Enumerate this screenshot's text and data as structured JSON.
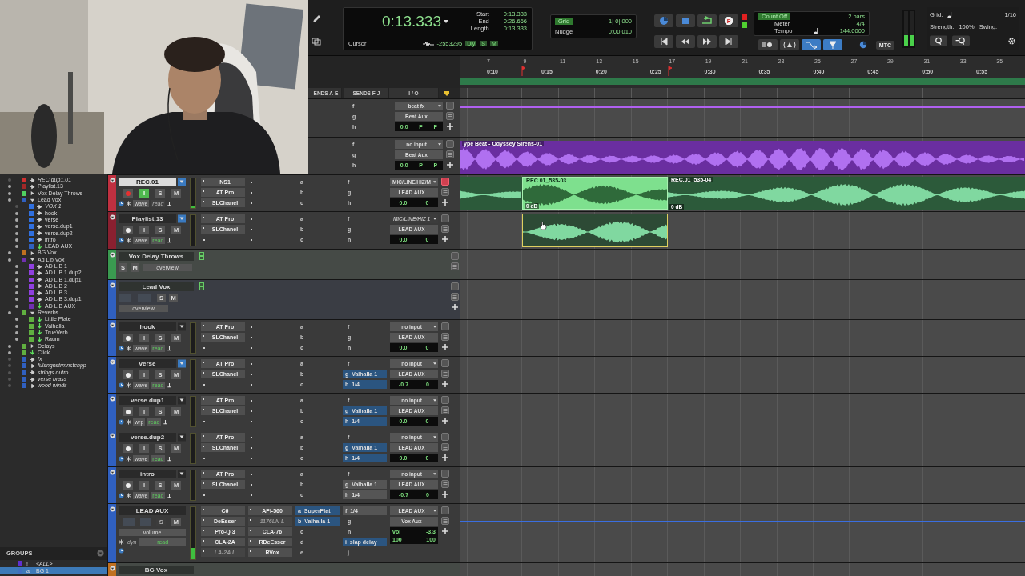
{
  "toolbar": {
    "counter": {
      "main": "0:13.333",
      "cursor_label": "Cursor",
      "cursor_value": "-2553295",
      "flags": [
        {
          "label": "Dly",
          "on": true
        },
        {
          "label": "S",
          "on": true
        },
        {
          "label": "M",
          "on": true
        }
      ],
      "rows": [
        {
          "label": "Start",
          "value": "0:13.333"
        },
        {
          "label": "End",
          "value": "0:26.666"
        },
        {
          "label": "Length",
          "value": "0:13.333"
        }
      ]
    },
    "grid": {
      "label": "Grid",
      "on": true,
      "value": "1| 0| 000",
      "nudge_label": "Nudge",
      "nudge_value": "0:00.010"
    },
    "record_label": "P",
    "count": {
      "count_off": "Count Off",
      "count_off_on": true,
      "bars": "2 bars",
      "meter_label": "Meter",
      "meter": "4/4",
      "tempo_label": "Tempo",
      "tempo": "144.0000"
    },
    "mode_buttons": [
      {
        "on": false
      },
      {
        "on": false
      },
      {
        "on": true
      },
      {
        "on": true
      }
    ],
    "sync_label": "MTC",
    "master_meter": [
      {
        "level": 0.32
      },
      {
        "level": 0.32
      }
    ],
    "quantize": {
      "grid_label": "Grid:",
      "grid_value": "1/16",
      "strength_label": "Strength:",
      "strength": "100%",
      "swing_label": "Swing:"
    }
  },
  "ruler": {
    "bars": [
      "7",
      "9",
      "11",
      "13",
      "15",
      "17",
      "19",
      "21",
      "23",
      "25",
      "27",
      "29",
      "31",
      "33",
      "35"
    ],
    "times": [
      "0:10",
      "0:15",
      "0:20",
      "0:25",
      "0:30",
      "0:35",
      "0:40",
      "0:45",
      "0:50",
      "0:55"
    ]
  },
  "track_list": [
    {
      "name": "REC.dup1.01",
      "kind": "audio",
      "color": "#d03030",
      "inactive": true
    },
    {
      "name": "Playlist.13",
      "kind": "audio",
      "color": "#a02828",
      "inactive": false
    },
    {
      "name": "Vox Delay Throws",
      "kind": "folder",
      "color": "#50d060",
      "inactive": false,
      "expanded": false
    },
    {
      "name": "Lead Vox",
      "kind": "folder",
      "color": "#3060c0",
      "inactive": false,
      "expanded": true,
      "children": [
        {
          "name": "VOX 1",
          "kind": "audio",
          "color": "#3070e0",
          "inactive": true
        },
        {
          "name": "hook",
          "kind": "audio",
          "color": "#3070e0",
          "inactive": false
        },
        {
          "name": "verse",
          "kind": "audio",
          "color": "#3070e0",
          "inactive": false
        },
        {
          "name": "verse.dup1",
          "kind": "audio",
          "color": "#3070e0",
          "inactive": false
        },
        {
          "name": "verse.dup2",
          "kind": "audio",
          "color": "#3070e0",
          "inactive": false
        },
        {
          "name": "intro",
          "kind": "audio",
          "color": "#3070e0",
          "inactive": false
        },
        {
          "name": "LEAD AUX",
          "kind": "aux",
          "color": "#3060c0",
          "inactive": false
        }
      ]
    },
    {
      "name": "BG Vox",
      "kind": "folder",
      "color": "#c07020",
      "inactive": false,
      "expanded": false
    },
    {
      "name": "Ad Lib Vox",
      "kind": "folder",
      "color": "#7030b0",
      "inactive": false,
      "expanded": true,
      "children": [
        {
          "name": "AD LIB 1",
          "kind": "audio",
          "color": "#9040e0",
          "inactive": false
        },
        {
          "name": "AD LIB 1.dup2",
          "kind": "audio",
          "color": "#9040e0",
          "inactive": false
        },
        {
          "name": "AD LIB 1.dup1",
          "kind": "audio",
          "color": "#9040e0",
          "inactive": false
        },
        {
          "name": "AD LIB 2",
          "kind": "audio",
          "color": "#9040e0",
          "inactive": false
        },
        {
          "name": "AD LIB 3",
          "kind": "audio",
          "color": "#9040e0",
          "inactive": false
        },
        {
          "name": "AD LIB 3.dup1",
          "kind": "audio",
          "color": "#9040e0",
          "inactive": false
        },
        {
          "name": "AD LIB AUX",
          "kind": "aux",
          "color": "#7030b0",
          "inactive": false
        }
      ]
    },
    {
      "name": "Reverbs",
      "kind": "folder",
      "color": "#60b040",
      "inactive": false,
      "expanded": true,
      "children": [
        {
          "name": "Little Plate",
          "kind": "aux",
          "color": "#60b040",
          "inactive": false
        },
        {
          "name": "Valhalla",
          "kind": "aux",
          "color": "#60b040",
          "inactive": false
        },
        {
          "name": "TrueVerb",
          "kind": "aux",
          "color": "#60b040",
          "inactive": false
        },
        {
          "name": "Raum",
          "kind": "aux",
          "color": "#60b040",
          "inactive": false
        }
      ]
    },
    {
      "name": "Delays",
      "kind": "folder",
      "color": "#60b040",
      "inactive": false,
      "expanded": false
    },
    {
      "name": "Click",
      "kind": "aux",
      "color": "#60b040",
      "inactive": false
    },
    {
      "name": "fx",
      "kind": "audio",
      "color": "#3060c0",
      "inactive": true
    },
    {
      "name": "fulsngnstrmnstchpp",
      "kind": "audio",
      "color": "#3060c0",
      "inactive": true
    },
    {
      "name": "strings outro",
      "kind": "audio",
      "color": "#3060c0",
      "inactive": true
    },
    {
      "name": "verse brass",
      "kind": "audio",
      "color": "#3060c0",
      "inactive": true
    },
    {
      "name": "wood winds",
      "kind": "audio",
      "color": "#3060c0",
      "inactive": true
    }
  ],
  "groups": {
    "title": "GROUPS",
    "items": [
      {
        "kind": "all",
        "tag": "!",
        "name": "<ALL>",
        "color": "#6030d0",
        "selected": false
      },
      {
        "kind": "group",
        "tag": "a",
        "name": "BG 1",
        "color": "#4070c0",
        "selected": true
      }
    ]
  },
  "columns": [
    "ENDS A-E",
    "SENDS F-J",
    "I / O"
  ],
  "tracks": [
    {
      "kind": "partial",
      "sends_fj": [
        {
          "letter": "f"
        },
        {
          "letter": "g"
        },
        {
          "letter": "h"
        }
      ],
      "io": {
        "input": "beat fx",
        "input_disabled": false,
        "output": "Beat Aux",
        "volume": "0.0",
        "pan": [
          "P",
          "P"
        ]
      },
      "has_add": true,
      "alert": false,
      "lane": {
        "kind": "line"
      }
    },
    {
      "kind": "partial",
      "sends_fj": [
        {
          "letter": "f"
        },
        {
          "letter": "g"
        },
        {
          "letter": "h"
        }
      ],
      "io": {
        "input": "no input",
        "input_disabled": false,
        "output": "Beat Aux",
        "volume": "0.0",
        "pan": [
          "P",
          "P"
        ]
      },
      "has_add": true,
      "alert": false,
      "lane": {
        "kind": "clips",
        "clips": [
          {
            "kind": "full",
            "name": "ype Beat - Odyssey Sirens-01"
          }
        ]
      }
    },
    {
      "kind": "audio",
      "name": "REC.01",
      "color": "#c03040",
      "selected": true,
      "playlist_lit": true,
      "buttons": [
        {
          "kind": "rec",
          "on": true
        },
        {
          "kind": "input",
          "label": "I",
          "on": true
        },
        {
          "kind": "solo",
          "label": "S",
          "on": false
        },
        {
          "kind": "mute",
          "label": "M",
          "on": false
        }
      ],
      "view": "wave",
      "automation": "read",
      "automation_on": false,
      "level": 0.08,
      "inserts_ae": [
        {
          "label": "NS1",
          "active": true
        },
        {
          "label": "AT Pro",
          "active": true
        },
        {
          "label": "SLChanel",
          "active": true
        }
      ],
      "sends_ae": [
        {
          "letter": "a"
        },
        {
          "letter": "b"
        },
        {
          "letter": "c"
        }
      ],
      "sends_fj": [
        {
          "letter": "f"
        },
        {
          "letter": "g"
        },
        {
          "letter": "h"
        }
      ],
      "io": {
        "input": "MIC/LINE/HIZ/M",
        "input_disabled": false,
        "output": "LEAD AUX",
        "volume": "0.0",
        "pan": [
          "0"
        ]
      },
      "has_add": true,
      "alert": true,
      "lane": {
        "kind": "clips",
        "clips": [
          {
            "kind": "edge"
          },
          {
            "kind": "selected",
            "name": "REC.01_535-03",
            "gain": "0 dB"
          },
          {
            "kind": "region",
            "name": "REC.01_535-04",
            "gain": "0 dB"
          }
        ]
      }
    },
    {
      "kind": "audio",
      "name": "Playlist.13",
      "color": "#8a2030",
      "selected": false,
      "playlist_lit": true,
      "buttons": [
        {
          "kind": "rec",
          "on": false
        },
        {
          "kind": "input",
          "label": "I",
          "on": false
        },
        {
          "kind": "solo",
          "label": "S",
          "on": false
        },
        {
          "kind": "mute",
          "label": "M",
          "on": false
        }
      ],
      "view": "wave",
      "automation": "read",
      "automation_on": true,
      "inserts_ae": [
        {
          "label": "AT Pro",
          "active": true
        },
        {
          "label": "SLChanel",
          "active": true
        }
      ],
      "sends_ae": [
        {
          "letter": "a"
        },
        {
          "letter": "b"
        },
        {
          "letter": "c"
        }
      ],
      "sends_fj": [
        {
          "letter": "f"
        },
        {
          "letter": "g"
        },
        {
          "letter": "h"
        }
      ],
      "io": {
        "input": "MIC/LINE/HIZ 1",
        "input_disabled": true,
        "output": "LEAD AUX",
        "volume": "0.0",
        "pan": [
          "0"
        ]
      },
      "has_add": true,
      "alert": false,
      "lane": {
        "kind": "clips",
        "clips": [
          {
            "kind": "outlined"
          }
        ]
      }
    },
    {
      "kind": "folder",
      "name": "Vox Delay Throws",
      "color": "#3a9a50",
      "buttons": [
        {
          "kind": "solo",
          "label": "S",
          "on": false
        },
        {
          "kind": "mute",
          "label": "M",
          "on": false
        }
      ],
      "view": "overview",
      "has_add": false,
      "alert": false,
      "lane": {
        "kind": "empty"
      }
    },
    {
      "kind": "folder",
      "name": "Lead Vox",
      "color": "#3060c0",
      "buttons": [
        {
          "kind": "blank"
        },
        {
          "kind": "blank"
        },
        {
          "kind": "solo",
          "label": "S",
          "on": false
        },
        {
          "kind": "mute",
          "label": "M",
          "on": false
        }
      ],
      "view": "overview",
      "has_add": true,
      "alert": false,
      "lane": {
        "kind": "empty"
      }
    },
    {
      "kind": "audio",
      "name": "hook",
      "color": "#3060c0",
      "selected": false,
      "playlist_lit": false,
      "buttons": [
        {
          "kind": "rec",
          "on": false
        },
        {
          "kind": "input",
          "label": "I",
          "on": false
        },
        {
          "kind": "solo",
          "label": "S",
          "on": false
        },
        {
          "kind": "mute",
          "label": "M",
          "on": false
        }
      ],
      "view": "wave",
      "automation": "read",
      "automation_on": true,
      "inserts_ae": [
        {
          "label": "AT Pro",
          "active": true
        },
        {
          "label": "SLChanel",
          "active": true
        }
      ],
      "sends_ae": [
        {
          "letter": "a"
        },
        {
          "letter": "b"
        },
        {
          "letter": "c"
        }
      ],
      "sends_fj": [
        {
          "letter": "f"
        },
        {
          "letter": "g"
        },
        {
          "letter": "h"
        }
      ],
      "io": {
        "input": "no input",
        "input_disabled": false,
        "output": "LEAD AUX",
        "volume": "0.0",
        "pan": [
          "0"
        ]
      },
      "has_add": true,
      "alert": false,
      "lane": {
        "kind": "empty"
      }
    },
    {
      "kind": "audio",
      "name": "verse",
      "color": "#3060c0",
      "selected": false,
      "playlist_lit": true,
      "buttons": [
        {
          "kind": "rec",
          "on": false
        },
        {
          "kind": "input",
          "label": "I",
          "on": false
        },
        {
          "kind": "solo",
          "label": "S",
          "on": false
        },
        {
          "kind": "mute",
          "label": "M",
          "on": false
        }
      ],
      "view": "wave",
      "automation": "read",
      "automation_on": true,
      "inserts_ae": [
        {
          "label": "AT Pro",
          "active": true
        },
        {
          "label": "SLChanel",
          "active": true
        }
      ],
      "sends_ae": [
        {
          "letter": "a"
        },
        {
          "letter": "b"
        },
        {
          "letter": "c"
        }
      ],
      "sends_fj": [
        {
          "letter": "f"
        },
        {
          "letter": "g",
          "label": "Valhalla 1",
          "active": true
        },
        {
          "letter": "h",
          "label": "1/4",
          "active": true
        }
      ],
      "io": {
        "input": "no input",
        "input_disabled": false,
        "output": "LEAD AUX",
        "volume": "-0.7",
        "pan": [
          "0"
        ]
      },
      "has_add": true,
      "alert": false,
      "lane": {
        "kind": "empty"
      }
    },
    {
      "kind": "audio",
      "name": "verse.dup1",
      "color": "#3060c0",
      "selected": false,
      "playlist_lit": false,
      "buttons": [
        {
          "kind": "rec",
          "on": false
        },
        {
          "kind": "input",
          "label": "I",
          "on": false
        },
        {
          "kind": "solo",
          "label": "S",
          "on": false
        },
        {
          "kind": "mute",
          "label": "M",
          "on": false
        }
      ],
      "view": "wrp",
      "automation": "read",
      "automation_on": true,
      "inserts_ae": [
        {
          "label": "AT Pro",
          "active": true
        },
        {
          "label": "SLChanel",
          "active": true
        }
      ],
      "sends_ae": [
        {
          "letter": "a"
        },
        {
          "letter": "b"
        },
        {
          "letter": "c"
        }
      ],
      "sends_fj": [
        {
          "letter": "f"
        },
        {
          "letter": "g",
          "label": "Valhalla 1",
          "active": true
        },
        {
          "letter": "h",
          "label": "1/4",
          "active": true
        }
      ],
      "io": {
        "input": "no input",
        "input_disabled": false,
        "output": "LEAD AUX",
        "volume": "0.0",
        "pan": [
          "0"
        ]
      },
      "has_add": true,
      "alert": false,
      "lane": {
        "kind": "empty"
      }
    },
    {
      "kind": "audio",
      "name": "verse.dup2",
      "color": "#3060c0",
      "selected": false,
      "playlist_lit": false,
      "buttons": [
        {
          "kind": "rec",
          "on": false
        },
        {
          "kind": "input",
          "label": "I",
          "on": false
        },
        {
          "kind": "solo",
          "label": "S",
          "on": false
        },
        {
          "kind": "mute",
          "label": "M",
          "on": false
        }
      ],
      "view": "wave",
      "automation": "read",
      "automation_on": true,
      "inserts_ae": [
        {
          "label": "AT Pro",
          "active": true
        },
        {
          "label": "SLChanel",
          "active": true
        }
      ],
      "sends_ae": [
        {
          "letter": "a"
        },
        {
          "letter": "b"
        },
        {
          "letter": "c"
        }
      ],
      "sends_fj": [
        {
          "letter": "f"
        },
        {
          "letter": "g",
          "label": "Valhalla 1",
          "active": true
        },
        {
          "letter": "h",
          "label": "1/4",
          "active": true
        }
      ],
      "io": {
        "input": "no input",
        "input_disabled": false,
        "output": "LEAD AUX",
        "volume": "0.0",
        "pan": [
          "0"
        ]
      },
      "has_add": true,
      "alert": false,
      "lane": {
        "kind": "empty"
      }
    },
    {
      "kind": "audio",
      "name": "intro",
      "color": "#3060c0",
      "selected": false,
      "playlist_lit": false,
      "buttons": [
        {
          "kind": "rec",
          "on": false
        },
        {
          "kind": "input",
          "label": "I",
          "on": false
        },
        {
          "kind": "solo",
          "label": "S",
          "on": false
        },
        {
          "kind": "mute",
          "label": "M",
          "on": false
        }
      ],
      "view": "wave",
      "automation": "read",
      "automation_on": true,
      "inserts_ae": [
        {
          "label": "AT Pro",
          "active": true
        },
        {
          "label": "SLChanel",
          "active": true
        }
      ],
      "sends_ae": [
        {
          "letter": "a"
        },
        {
          "letter": "b"
        },
        {
          "letter": "c"
        }
      ],
      "sends_fj": [
        {
          "letter": "f"
        },
        {
          "letter": "g",
          "label": "Valhalla 1",
          "active": false
        },
        {
          "letter": "h",
          "label": "1/4",
          "active": false
        }
      ],
      "io": {
        "input": "no input",
        "input_disabled": false,
        "output": "LEAD AUX",
        "volume": "-0.7",
        "pan": [
          "0"
        ]
      },
      "has_add": true,
      "alert": false,
      "lane": {
        "kind": "empty"
      }
    },
    {
      "kind": "aux",
      "name": "LEAD AUX",
      "color": "#3060c0",
      "buttons": [
        {
          "kind": "blank"
        },
        {
          "kind": "blank"
        },
        {
          "kind": "solo",
          "label": "S",
          "on": false,
          "disabled": true
        },
        {
          "kind": "mute",
          "label": "M",
          "on": false
        }
      ],
      "view": "volume",
      "mode": "dyn",
      "mode_on": false,
      "automation": "read",
      "automation_on": true,
      "level": 0.22,
      "inserts_ae": [
        {
          "label": "C6",
          "active": true
        },
        {
          "label": "DeEsser",
          "active": true
        },
        {
          "label": "Pro-Q 3",
          "active": true
        },
        {
          "label": "CLA-2A",
          "active": true
        },
        {
          "label": "LA-2A L",
          "active": false
        }
      ],
      "inserts_fj": [
        {
          "label": "API-560",
          "active": true
        },
        {
          "label": "1176LN L",
          "active": false
        },
        {
          "label": "CLA-76",
          "active": true
        },
        {
          "label": "RDeEsser",
          "active": true
        },
        {
          "label": "RVox",
          "active": true
        }
      ],
      "sends_ae": [
        {
          "letter": "a",
          "label": "SuperPlat",
          "active": true
        },
        {
          "letter": "b",
          "label": "Valhalla 1",
          "active": true
        },
        {
          "letter": "c"
        },
        {
          "letter": "d"
        },
        {
          "letter": "e"
        }
      ],
      "sends_fj": [
        {
          "letter": "f",
          "label": "1/4",
          "active": false
        },
        {
          "letter": "g"
        },
        {
          "letter": "h"
        },
        {
          "letter": "i",
          "label": "slap delay",
          "active": true
        },
        {
          "letter": "j"
        }
      ],
      "io": {
        "input": "LEAD AUX",
        "input_disabled": false,
        "output": "Vox Aux",
        "volume_label": "vol",
        "volume": "-3.3",
        "pan": [
          "100",
          "100"
        ]
      },
      "has_add": true,
      "alert": false,
      "lane": {
        "kind": "line"
      }
    },
    {
      "kind": "folder",
      "name": "BG Vox",
      "color": "#c07020",
      "lane": {
        "kind": "empty"
      }
    }
  ]
}
